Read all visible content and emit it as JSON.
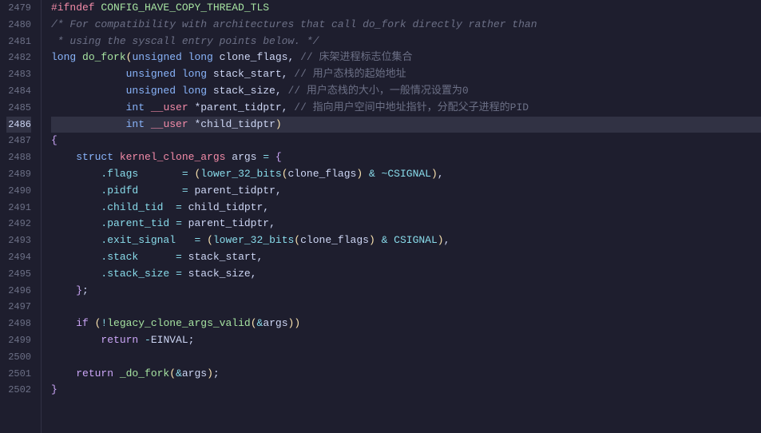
{
  "editor": {
    "lines": [
      {
        "num": "2479",
        "active": false,
        "tokens": [
          {
            "t": "preproc",
            "v": "#ifndef "
          },
          {
            "t": "preproc-val",
            "v": "CONFIG_HAVE_COPY_THREAD_TLS"
          }
        ]
      },
      {
        "num": "2480",
        "active": false,
        "tokens": [
          {
            "t": "comment",
            "v": "/* For compatibility with architectures that call do_fork directly rather than"
          }
        ]
      },
      {
        "num": "2481",
        "active": false,
        "tokens": [
          {
            "t": "comment",
            "v": " * using the syscall entry points below. */"
          }
        ]
      },
      {
        "num": "2482",
        "active": false,
        "tokens": [
          {
            "t": "kw",
            "v": "long "
          },
          {
            "t": "fn2",
            "v": "do_fork"
          },
          {
            "t": "paren",
            "v": "("
          },
          {
            "t": "kw",
            "v": "unsigned long "
          },
          {
            "t": "var",
            "v": "clone_flags"
          },
          {
            "t": "var",
            "v": ", "
          },
          {
            "t": "comment-cn",
            "v": "// 床架进程标志位集合"
          }
        ]
      },
      {
        "num": "2483",
        "active": false,
        "tokens": [
          {
            "t": "var",
            "v": "            "
          },
          {
            "t": "kw",
            "v": "unsigned long "
          },
          {
            "t": "var",
            "v": "stack_start"
          },
          {
            "t": "var",
            "v": ", "
          },
          {
            "t": "comment-cn",
            "v": "// 用户态栈的起始地址"
          }
        ]
      },
      {
        "num": "2484",
        "active": false,
        "tokens": [
          {
            "t": "var",
            "v": "            "
          },
          {
            "t": "kw",
            "v": "unsigned long "
          },
          {
            "t": "var",
            "v": "stack_size"
          },
          {
            "t": "var",
            "v": ", "
          },
          {
            "t": "comment-cn",
            "v": "// 用户态栈的大小，一般情况设置为0"
          }
        ]
      },
      {
        "num": "2485",
        "active": false,
        "tokens": [
          {
            "t": "var",
            "v": "            "
          },
          {
            "t": "kw",
            "v": "int "
          },
          {
            "t": "user-kw",
            "v": "__user "
          },
          {
            "t": "var",
            "v": "*parent_tidptr"
          },
          {
            "t": "var",
            "v": ", "
          },
          {
            "t": "comment-cn",
            "v": "// 指向用户空间中地址指针，分配父子进程的PID"
          }
        ]
      },
      {
        "num": "2486",
        "active": true,
        "tokens": [
          {
            "t": "var",
            "v": "            "
          },
          {
            "t": "kw",
            "v": "int "
          },
          {
            "t": "user-kw",
            "v": "__user "
          },
          {
            "t": "var",
            "v": "*child_tidptr"
          },
          {
            "t": "paren",
            "v": ")"
          }
        ]
      },
      {
        "num": "2487",
        "active": false,
        "tokens": [
          {
            "t": "bracket",
            "v": "{"
          }
        ]
      },
      {
        "num": "2488",
        "active": false,
        "tokens": [
          {
            "t": "var",
            "v": "    "
          },
          {
            "t": "kw",
            "v": "struct "
          },
          {
            "t": "type",
            "v": "kernel_clone_args "
          },
          {
            "t": "var",
            "v": "args "
          },
          {
            "t": "op",
            "v": "= "
          },
          {
            "t": "bracket",
            "v": "{"
          }
        ]
      },
      {
        "num": "2489",
        "active": false,
        "tokens": [
          {
            "t": "var",
            "v": "        "
          },
          {
            "t": "field",
            "v": ".flags"
          },
          {
            "t": "var",
            "v": "       "
          },
          {
            "t": "op",
            "v": "= "
          },
          {
            "t": "paren",
            "v": "("
          },
          {
            "t": "fn",
            "v": "lower_32_bits"
          },
          {
            "t": "paren",
            "v": "("
          },
          {
            "t": "var",
            "v": "clone_flags"
          },
          {
            "t": "paren",
            "v": ")"
          },
          {
            "t": "var",
            "v": " "
          },
          {
            "t": "op",
            "v": "& ~"
          },
          {
            "t": "csig",
            "v": "CSIGNAL"
          },
          {
            "t": "paren",
            "v": ")"
          },
          {
            "t": "var",
            "v": ","
          }
        ]
      },
      {
        "num": "2490",
        "active": false,
        "tokens": [
          {
            "t": "var",
            "v": "        "
          },
          {
            "t": "field",
            "v": ".pidfd"
          },
          {
            "t": "var",
            "v": "       "
          },
          {
            "t": "op",
            "v": "= "
          },
          {
            "t": "var",
            "v": "parent_tidptr,"
          }
        ]
      },
      {
        "num": "2491",
        "active": false,
        "tokens": [
          {
            "t": "var",
            "v": "        "
          },
          {
            "t": "field",
            "v": ".child_tid"
          },
          {
            "t": "var",
            "v": "  "
          },
          {
            "t": "op",
            "v": "= "
          },
          {
            "t": "var",
            "v": "child_tidptr,"
          }
        ]
      },
      {
        "num": "2492",
        "active": false,
        "tokens": [
          {
            "t": "var",
            "v": "        "
          },
          {
            "t": "field",
            "v": ".parent_tid"
          },
          {
            "t": "var",
            "v": " "
          },
          {
            "t": "op",
            "v": "= "
          },
          {
            "t": "var",
            "v": "parent_tidptr,"
          }
        ]
      },
      {
        "num": "2493",
        "active": false,
        "tokens": [
          {
            "t": "var",
            "v": "        "
          },
          {
            "t": "field",
            "v": ".exit_signal"
          },
          {
            "t": "var",
            "v": "   "
          },
          {
            "t": "op",
            "v": "= "
          },
          {
            "t": "paren",
            "v": "("
          },
          {
            "t": "fn",
            "v": "lower_32_bits"
          },
          {
            "t": "paren",
            "v": "("
          },
          {
            "t": "var",
            "v": "clone_flags"
          },
          {
            "t": "paren",
            "v": ")"
          },
          {
            "t": "var",
            "v": " "
          },
          {
            "t": "op",
            "v": "& "
          },
          {
            "t": "csig",
            "v": "CSIGNAL"
          },
          {
            "t": "paren",
            "v": ")"
          },
          {
            "t": "var",
            "v": ","
          }
        ]
      },
      {
        "num": "2494",
        "active": false,
        "tokens": [
          {
            "t": "var",
            "v": "        "
          },
          {
            "t": "field",
            "v": ".stack"
          },
          {
            "t": "var",
            "v": "      "
          },
          {
            "t": "op",
            "v": "= "
          },
          {
            "t": "var",
            "v": "stack_start,"
          }
        ]
      },
      {
        "num": "2495",
        "active": false,
        "tokens": [
          {
            "t": "var",
            "v": "        "
          },
          {
            "t": "field",
            "v": ".stack_size"
          },
          {
            "t": "var",
            "v": " "
          },
          {
            "t": "op",
            "v": "= "
          },
          {
            "t": "var",
            "v": "stack_size,"
          }
        ]
      },
      {
        "num": "2496",
        "active": false,
        "tokens": [
          {
            "t": "var",
            "v": "    "
          },
          {
            "t": "bracket",
            "v": "}"
          },
          {
            "t": "var",
            "v": ";"
          }
        ]
      },
      {
        "num": "2497",
        "active": false,
        "tokens": []
      },
      {
        "num": "2498",
        "active": false,
        "tokens": [
          {
            "t": "var",
            "v": "    "
          },
          {
            "t": "kw2",
            "v": "if "
          },
          {
            "t": "paren",
            "v": "("
          },
          {
            "t": "op",
            "v": "!"
          },
          {
            "t": "fn2",
            "v": "legacy_clone_args_valid"
          },
          {
            "t": "paren",
            "v": "("
          },
          {
            "t": "op",
            "v": "&"
          },
          {
            "t": "var",
            "v": "args"
          },
          {
            "t": "paren",
            "v": "))"
          }
        ]
      },
      {
        "num": "2499",
        "active": false,
        "tokens": [
          {
            "t": "var",
            "v": "        "
          },
          {
            "t": "kw2",
            "v": "return "
          },
          {
            "t": "op",
            "v": "-"
          },
          {
            "t": "var",
            "v": "EINVAL;"
          }
        ]
      },
      {
        "num": "2500",
        "active": false,
        "tokens": []
      },
      {
        "num": "2501",
        "active": false,
        "tokens": [
          {
            "t": "var",
            "v": "    "
          },
          {
            "t": "kw2",
            "v": "return "
          },
          {
            "t": "fn2",
            "v": "_do_fork"
          },
          {
            "t": "paren",
            "v": "("
          },
          {
            "t": "op",
            "v": "&"
          },
          {
            "t": "var",
            "v": "args"
          },
          {
            "t": "paren",
            "v": ")"
          },
          {
            "t": "var",
            "v": ";"
          }
        ]
      },
      {
        "num": "2502",
        "active": false,
        "tokens": [
          {
            "t": "bracket",
            "v": "}"
          }
        ]
      }
    ]
  }
}
